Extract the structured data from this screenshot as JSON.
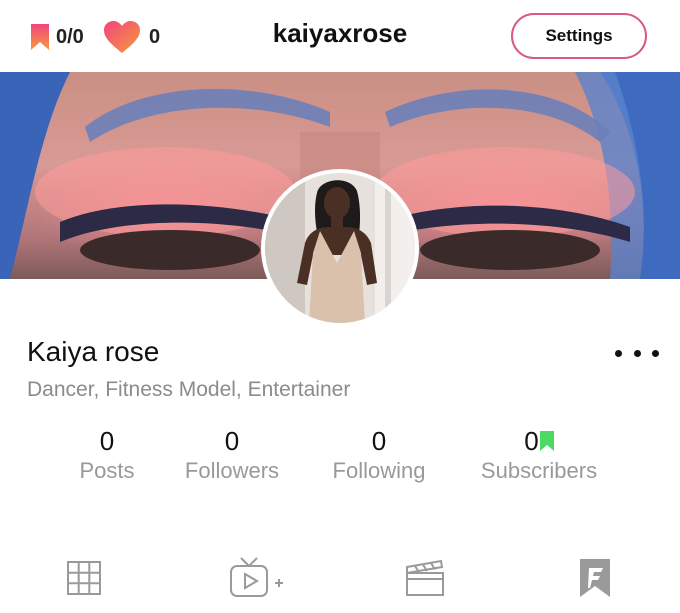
{
  "header": {
    "bookmarks_count": "0/0",
    "likes_count": "0",
    "username": "kaiyaxrose",
    "settings_label": "Settings"
  },
  "profile": {
    "display_name": "Kaiya rose",
    "bio": "Dancer, Fitness Model, Entertainer"
  },
  "stats": [
    {
      "value": "0",
      "label": "Posts"
    },
    {
      "value": "0",
      "label": "Followers"
    },
    {
      "value": "0",
      "label": "Following"
    },
    {
      "value": "0",
      "label": "Subscribers"
    }
  ],
  "tabs": [
    {
      "icon": "grid-icon"
    },
    {
      "icon": "video-add-icon"
    },
    {
      "icon": "clapperboard-icon"
    },
    {
      "icon": "bookmark-logo-icon"
    }
  ],
  "colors": {
    "accent_pink": "#d95a7c",
    "bookmark_gradient": [
      "#f0457e",
      "#f79a3c"
    ],
    "subscriber_badge": "#4cd964",
    "muted_text": "#999999"
  }
}
